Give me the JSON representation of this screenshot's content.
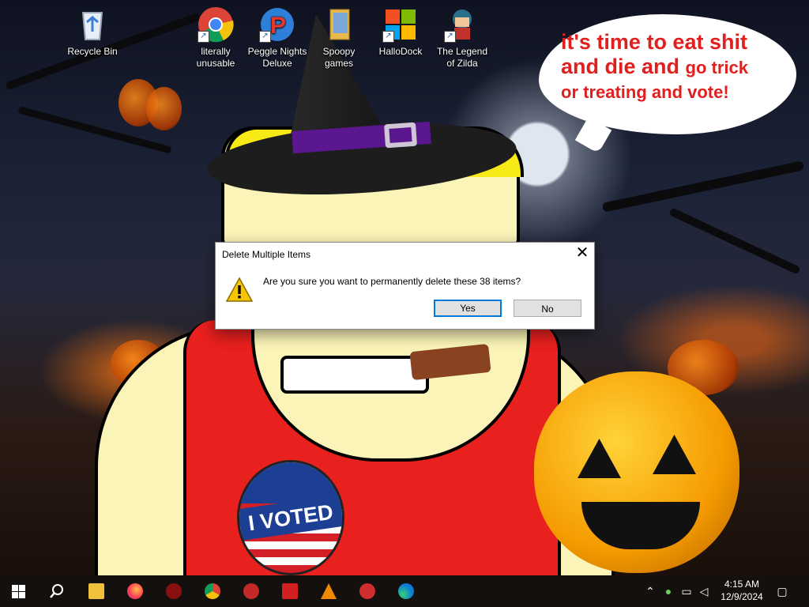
{
  "desktop": {
    "icons": [
      {
        "label": "Recycle Bin",
        "icon": "recycle-bin-icon"
      },
      {
        "label": "literally\nunusable",
        "icon": "chrome-icon"
      },
      {
        "label": "Peggle Nights\nDeluxe",
        "icon": "peggle-icon"
      },
      {
        "label": "Spoopy\ngames",
        "icon": "folder-icon"
      },
      {
        "label": "HalloDock",
        "icon": "windows-logo-icon"
      },
      {
        "label": "The Legend\nof Zilda",
        "icon": "game-character-icon"
      }
    ],
    "wallpaper": {
      "speech_bubble_line1": "it's time to eat shit",
      "speech_bubble_line2a": "and die and",
      "speech_bubble_line2b": "go trick",
      "speech_bubble_line3": "or treating and vote!",
      "sticker_text": "I VOTED"
    }
  },
  "dialog": {
    "title": "Delete Multiple Items",
    "message": "Are you sure you want to permanently delete these 38 items?",
    "yes_label": "Yes",
    "no_label": "No",
    "close_glyph": "✕",
    "icon": "warning-icon"
  },
  "taskbar": {
    "start_icon": "windows-start-icon",
    "search_icon": "search-icon",
    "pinned": [
      "file-explorer-icon",
      "firefox-icon",
      "app-icon",
      "chrome-icon",
      "app-icon",
      "flash-icon",
      "vlc-icon",
      "app-icon",
      "edge-icon"
    ],
    "time": "4:15 AM",
    "date": "12/9/2024"
  },
  "colors": {
    "accent": "#0078d7",
    "taskbar": "#14100e",
    "bubble_text": "#e0201e"
  }
}
